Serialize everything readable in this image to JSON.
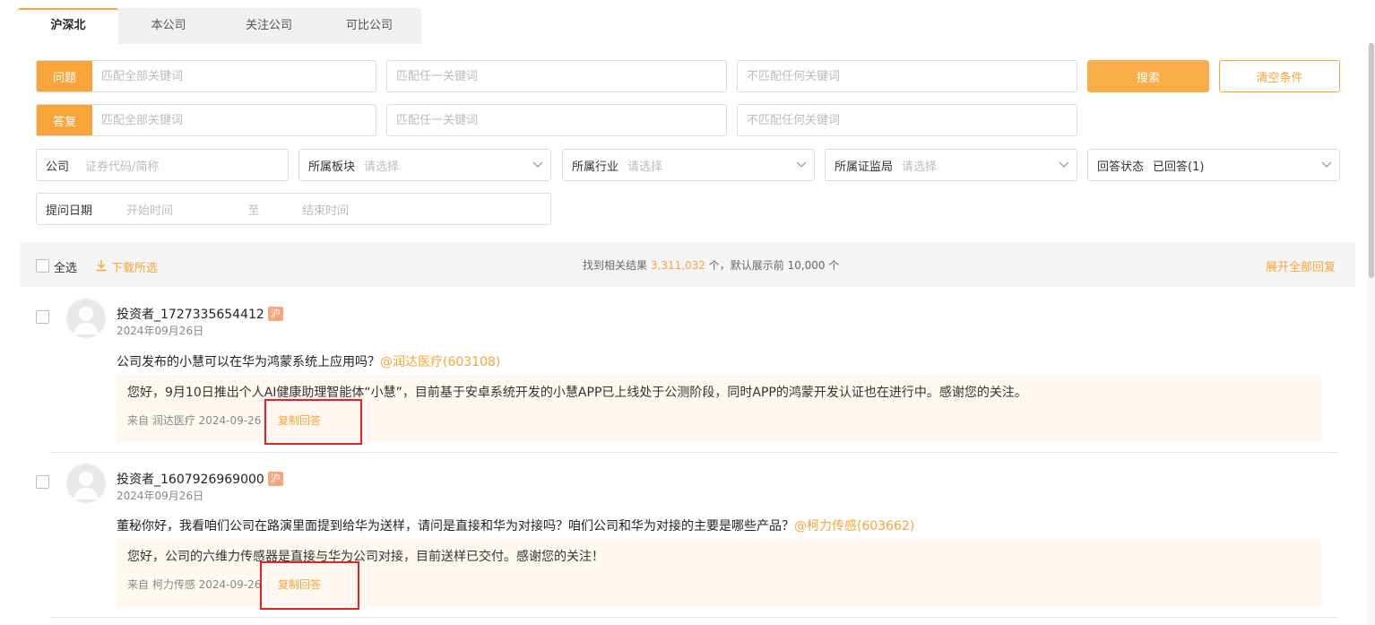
{
  "tabs": [
    "沪深北",
    "本公司",
    "关注公司",
    "可比公司"
  ],
  "question_filter": {
    "tag": "问题",
    "all_placeholder": "匹配全部关键词",
    "any_placeholder": "匹配任一关键词",
    "none_placeholder": "不匹配任何关键词"
  },
  "answer_filter": {
    "tag": "答复",
    "all_placeholder": "匹配全部关键词",
    "any_placeholder": "匹配任一关键词",
    "none_placeholder": "不匹配任何关键词"
  },
  "buttons": {
    "search": "搜索",
    "clear": "清空条件"
  },
  "filters": {
    "company_label": "公司",
    "company_placeholder": "证券代码/简称",
    "sector_label": "所属板块",
    "sector_placeholder": "请选择",
    "industry_label": "所属行业",
    "industry_placeholder": "请选择",
    "regulator_label": "所属证监局",
    "regulator_placeholder": "请选择",
    "status_label": "回答状态",
    "status_value": "已回答(1)",
    "date_label": "提问日期",
    "date_start": "开始时间",
    "date_to": "至",
    "date_end": "结束时间"
  },
  "results_bar": {
    "select_all": "全选",
    "download": "下载所选",
    "found_prefix": "找到相关结果",
    "found_count": "3,311,032",
    "found_suffix": "个，默认展示前 10,000 个",
    "expand_all": "展开全部回复"
  },
  "items": [
    {
      "user": "投资者_1727335654412",
      "market_badge": "沪",
      "date": "2024年09月26日",
      "question": "公司发布的小慧可以在华为鸿蒙系统上应用吗？",
      "company_mention": "@润达医疗(603108)",
      "answer": "您好，9月10日推出个人AI健康助理智能体“小慧”，目前基于安卓系统开发的小慧APP已上线处于公测阶段，同时APP的鸿蒙开发认证也在进行中。感谢您的关注。",
      "from": "来自 润达医疗 2024-09-26",
      "copy": "复制回答"
    },
    {
      "user": "投资者_1607926969000",
      "market_badge": "沪",
      "date": "2024年09月26日",
      "question": "董秘你好，我看咱们公司在路演里面提到给华为送样，请问是直接和华为对接吗？咱们公司和华为对接的主要是哪些产品？",
      "company_mention": "@柯力传感(603662)",
      "answer": "您好，公司的六维力传感器是直接与华为公司对接，目前送样已交付。感谢您的关注！",
      "from": "来自 柯力传感 2024-09-26",
      "copy": "复制回答"
    }
  ],
  "colors": {
    "accent": "#f7a43a",
    "highlight_box": "#e32222",
    "answer_bg": "#fff8f0"
  }
}
